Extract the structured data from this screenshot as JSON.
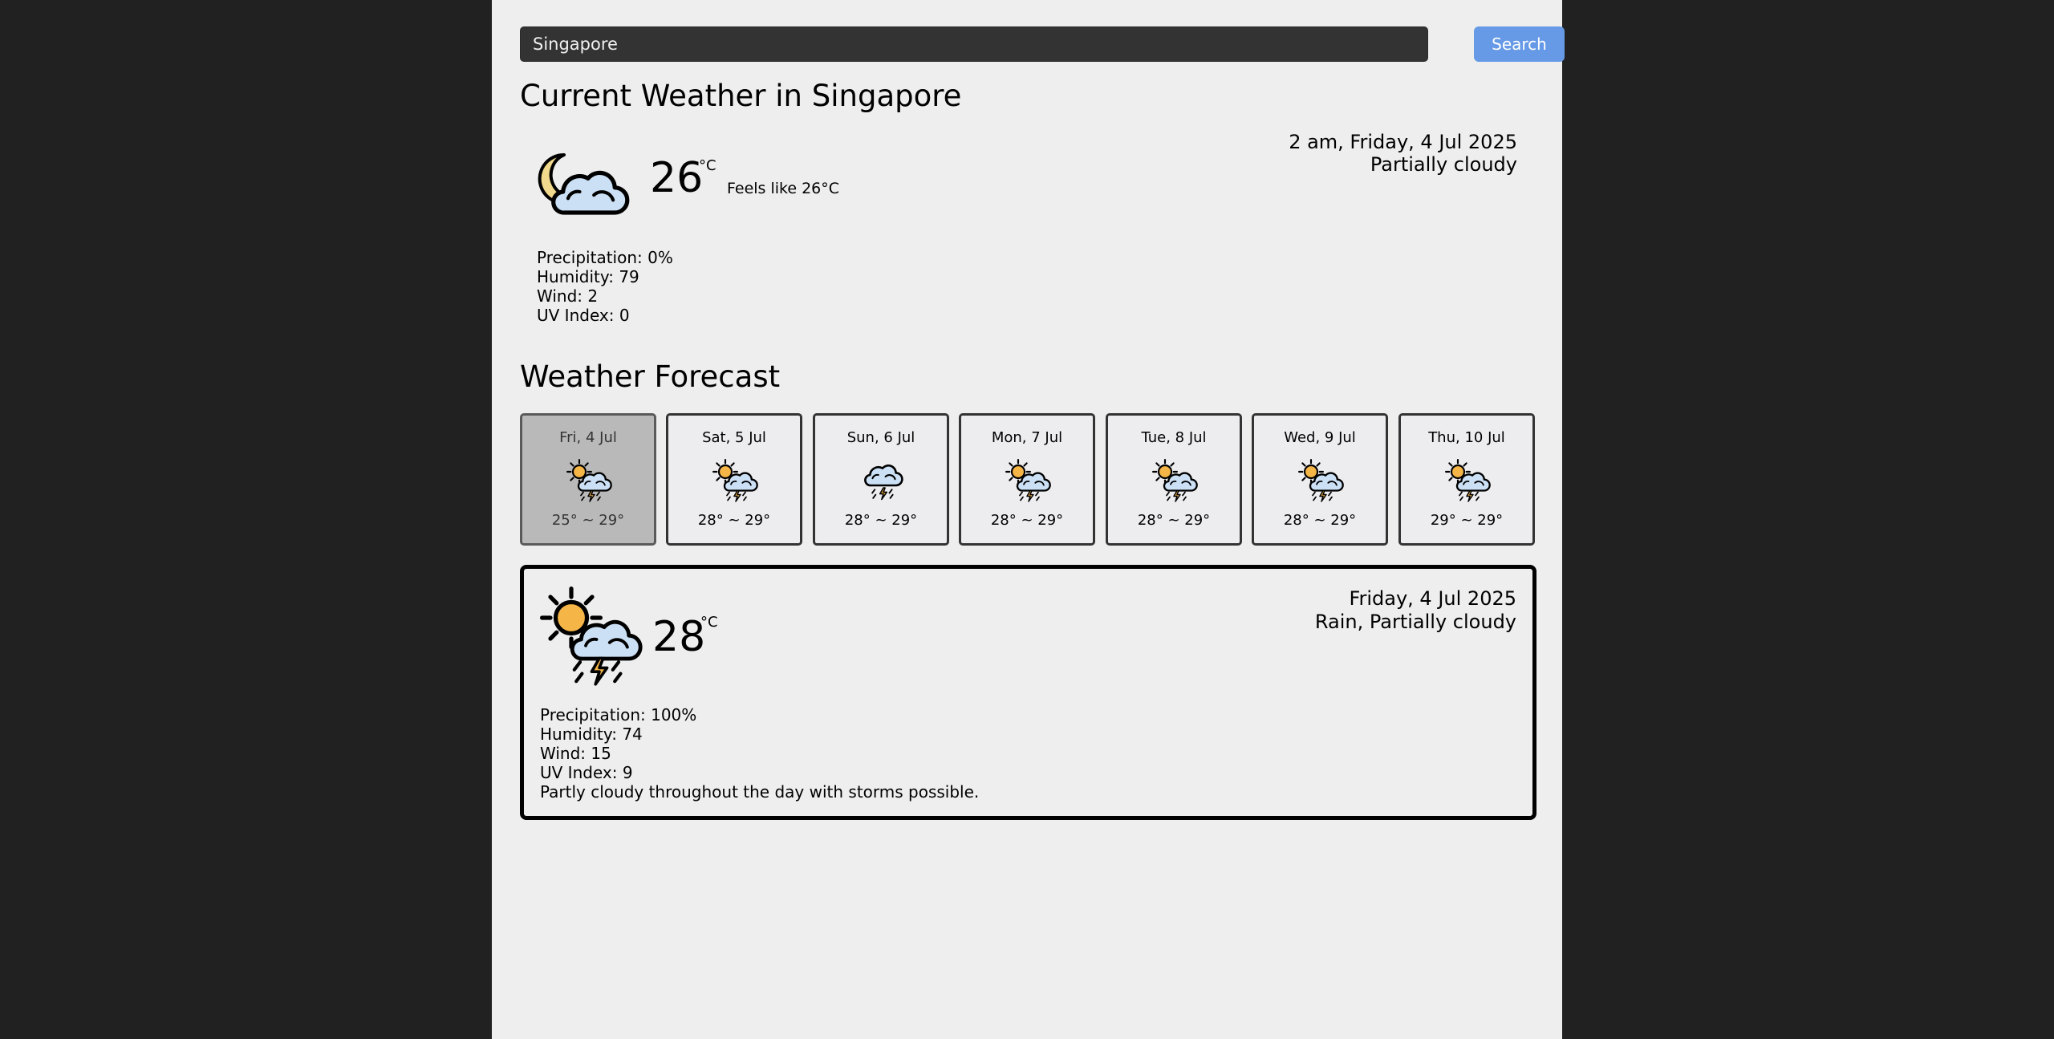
{
  "search": {
    "value": "Singapore",
    "button_label": "Search"
  },
  "current": {
    "title": "Current Weather in Singapore",
    "icon": "partly-cloudy-night-icon",
    "temp": "26",
    "unit": "°C",
    "feels_like": "Feels like 26°C",
    "datetime": "2 am, Friday, 4 Jul 2025",
    "condition": "Partially cloudy",
    "details": [
      "Precipitation: 0%",
      "Humidity: 79",
      "Wind: 2",
      "UV Index: 0"
    ]
  },
  "forecast": {
    "title": "Weather Forecast",
    "days": [
      {
        "label": "Fri, 4 Jul",
        "temp_range": "25° ~ 29°",
        "icon": "thunder-rain-sun-icon",
        "selected": true
      },
      {
        "label": "Sat, 5 Jul",
        "temp_range": "28° ~ 29°",
        "icon": "thunder-rain-sun-icon",
        "selected": false
      },
      {
        "label": "Sun, 6 Jul",
        "temp_range": "28° ~ 29°",
        "icon": "thunder-rain-icon",
        "selected": false
      },
      {
        "label": "Mon, 7 Jul",
        "temp_range": "28° ~ 29°",
        "icon": "thunder-rain-sun-icon",
        "selected": false
      },
      {
        "label": "Tue, 8 Jul",
        "temp_range": "28° ~ 29°",
        "icon": "thunder-rain-sun-icon",
        "selected": false
      },
      {
        "label": "Wed, 9 Jul",
        "temp_range": "28° ~ 29°",
        "icon": "thunder-rain-sun-icon",
        "selected": false
      },
      {
        "label": "Thu, 10 Jul",
        "temp_range": "29° ~ 29°",
        "icon": "thunder-rain-sun-icon",
        "selected": false
      }
    ]
  },
  "selected_day": {
    "icon": "thunder-rain-sun-icon",
    "temp": "28",
    "unit": "°C",
    "date": "Friday, 4 Jul 2025",
    "condition": "Rain, Partially cloudy",
    "details": [
      "Precipitation: 100%",
      "Humidity: 74",
      "Wind: 15",
      "UV Index: 9",
      "Partly cloudy throughout the day with storms possible."
    ]
  },
  "colors": {
    "background": "#212121",
    "panel": "#eeeeee",
    "search_input": "#333333",
    "search_button": "#6699e6",
    "selected_card": "#b9b9b9",
    "sun": "#f5b547",
    "moon": "#f0d98c",
    "cloud": "#cce0f5"
  }
}
